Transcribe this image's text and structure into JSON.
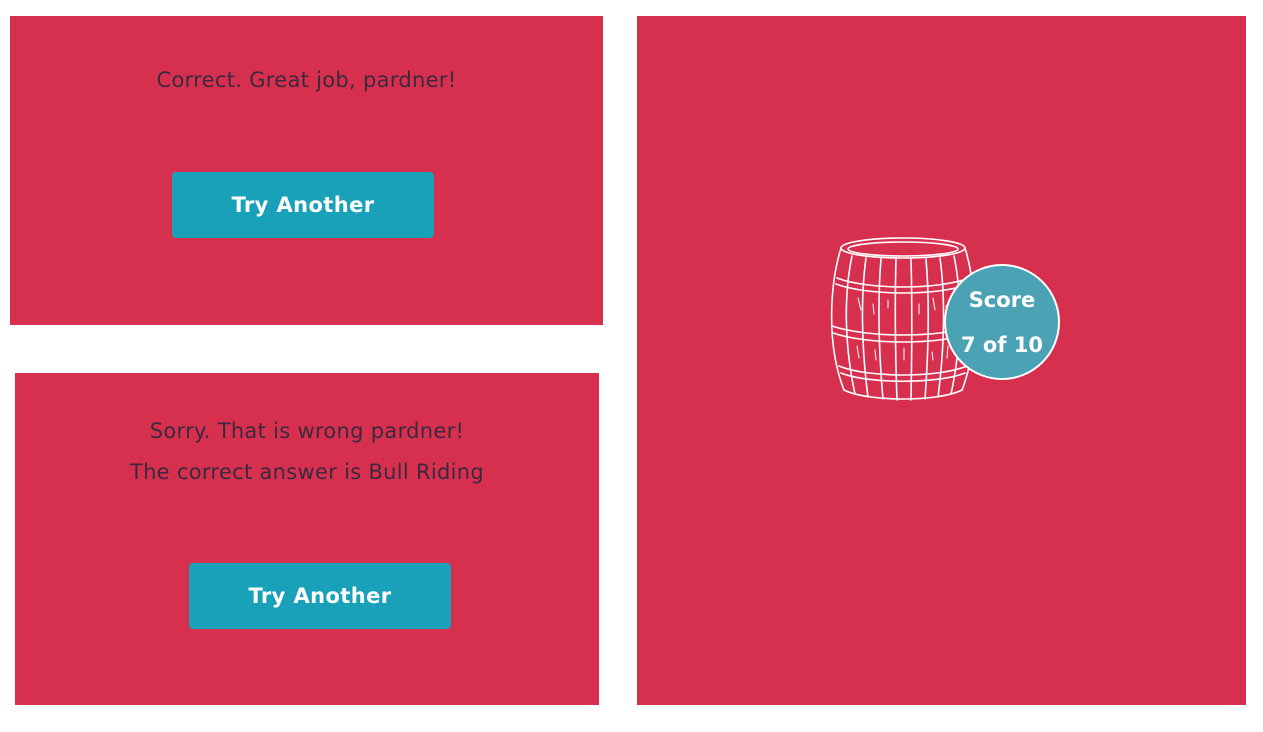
{
  "feedback_correct": {
    "message": "Correct. Great job, pardner!",
    "button_label": "Try Another"
  },
  "feedback_wrong": {
    "message": "Sorry. That is wrong pardner!",
    "answer_line": "The correct answer is Bull Riding",
    "button_label": "Try Another"
  },
  "score": {
    "label": "Score",
    "value": "7 of 10",
    "image_icon": "barrel-icon"
  },
  "colors": {
    "panel_background": "#d72f4e",
    "button_background": "#18a1b8",
    "badge_background": "#4aa2b4",
    "message_text": "#3b2a3f"
  }
}
